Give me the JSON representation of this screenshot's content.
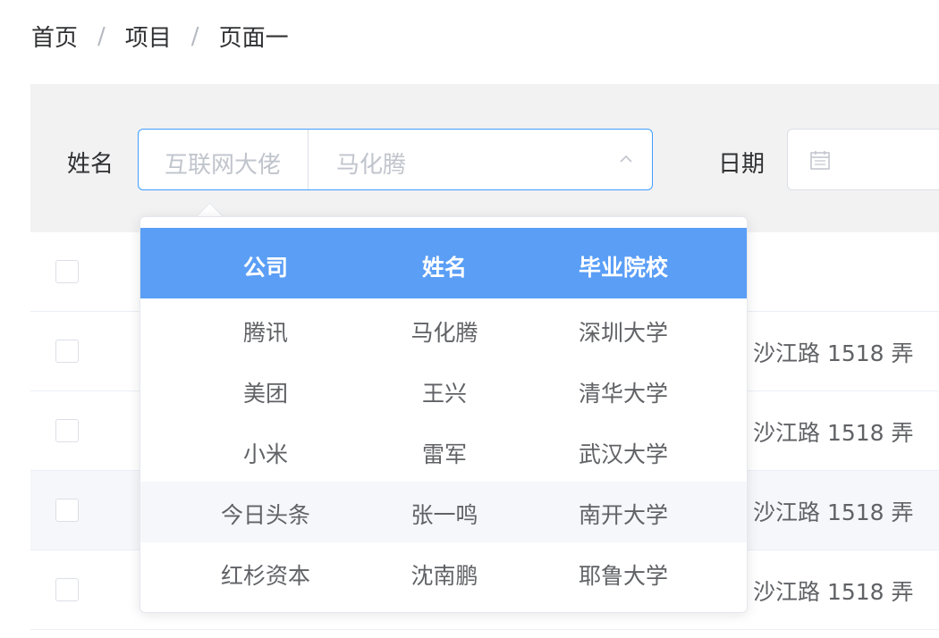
{
  "breadcrumb": {
    "items": [
      "首页",
      "项目",
      "页面一"
    ],
    "separator": "/"
  },
  "filter": {
    "name_label": "姓名",
    "name_placeholder_1": "互联网大佬",
    "name_placeholder_2": "马化腾",
    "date_label": "日期"
  },
  "table": {
    "address_text": "沙江路 1518 弄"
  },
  "dropdown": {
    "headers": [
      "公司",
      "姓名",
      "毕业院校"
    ],
    "header_color": "#5a9ef6",
    "rows": [
      [
        "腾讯",
        "马化腾",
        "深圳大学"
      ],
      [
        "美团",
        "王兴",
        "清华大学"
      ],
      [
        "小米",
        "雷军",
        "武汉大学"
      ],
      [
        "今日头条",
        "张一鸣",
        "南开大学"
      ],
      [
        "红杉资本",
        "沈南鹏",
        "耶鲁大学"
      ]
    ]
  },
  "icons": {
    "dropdown_toggle": "chevron-up-icon",
    "date": "calendar-icon"
  }
}
